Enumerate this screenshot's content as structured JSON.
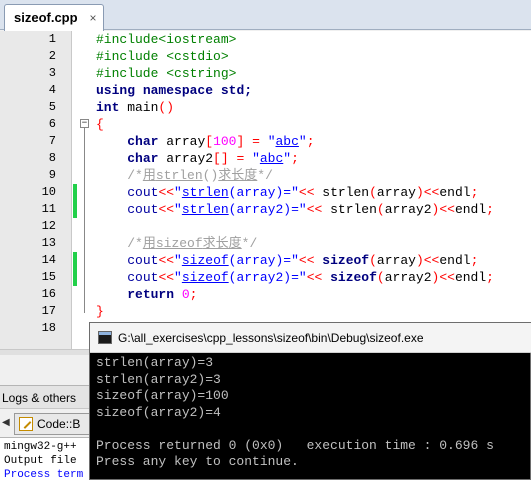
{
  "tab": {
    "filename": "sizeof.cpp",
    "close_glyph": "×"
  },
  "editor": {
    "line_numbers": [
      "1",
      "2",
      "3",
      "4",
      "5",
      "6",
      "7",
      "8",
      "9",
      "10",
      "11",
      "12",
      "13",
      "14",
      "15",
      "16",
      "17",
      "18"
    ],
    "code": {
      "l1": "#include<iostream>",
      "l2": "#include <cstdio>",
      "l3": "#include <cstring>",
      "l4_kw1": "using",
      "l4_kw2": "namespace",
      "l4_rest": " std;",
      "l5_type": "int",
      "l5_name": " main",
      "l5_parens": "()",
      "l6": "{",
      "l7_type": "char",
      "l7_var": " array",
      "l7_ob": "[",
      "l7_num": "100",
      "l7_cb": "]",
      "l7_eq": " = ",
      "l7_q1": "\"",
      "l7_str": "abc",
      "l7_q2": "\"",
      "l7_semi": ";",
      "l8_type": "char",
      "l8_var": " array2",
      "l8_brk": "[]",
      "l8_eq": " = ",
      "l8_q1": "\"",
      "l8_str": "abc",
      "l8_q2": "\"",
      "l8_semi": ";",
      "l9_open": "/*",
      "l9_han1": "用",
      "l9_fn": "strlen",
      "l9_paren": "()",
      "l9_han2": "求长度",
      "l9_close": "*/",
      "l10_cout": "cout",
      "l10_op": "<<",
      "l10_q1": "\"",
      "l10_fn": "strlen",
      "l10_strrest": "(array)=\"",
      "l10_op2": "<<",
      "l10_call": " strlen",
      "l10_p1": "(",
      "l10_arg": "array",
      "l10_p2": ")",
      "l10_op3": "<<",
      "l10_endl": "endl",
      "l10_semi": ";",
      "l11_cout": "cout",
      "l11_op": "<<",
      "l11_q1": "\"",
      "l11_fn": "strlen",
      "l11_strrest": "(array2)=\"",
      "l11_op2": "<<",
      "l11_call": " strlen",
      "l11_p1": "(",
      "l11_arg": "array2",
      "l11_p2": ")",
      "l11_op3": "<<",
      "l11_endl": "endl",
      "l11_semi": ";",
      "l13_open": "/*",
      "l13_han1": "用",
      "l13_fn": "sizeof",
      "l13_han2": "求长度",
      "l13_close": "*/",
      "l14_cout": "cout",
      "l14_op": "<<",
      "l14_q1": "\"",
      "l14_fn": "sizeof",
      "l14_strrest": "(array)=\"",
      "l14_op2": "<< ",
      "l14_kw": "sizeof",
      "l14_p1": "(",
      "l14_arg": "array",
      "l14_p2": ")",
      "l14_op3": "<<",
      "l14_endl": "endl",
      "l14_semi": ";",
      "l15_cout": "cout",
      "l15_op": "<<",
      "l15_q1": "\"",
      "l15_fn": "sizeof",
      "l15_strrest": "(array2)=\"",
      "l15_op2": "<< ",
      "l15_kw": "sizeof",
      "l15_p1": "(",
      "l15_arg": "array2",
      "l15_p2": ")",
      "l15_op3": "<<",
      "l15_endl": "endl",
      "l15_semi": ";",
      "l16_kw": "return",
      "l16_num": " 0",
      "l16_semi": ";",
      "l17": "}"
    }
  },
  "logs": {
    "title": "Logs & others",
    "tab_label": "Code::B",
    "back_glyph": "◀",
    "lines": [
      "mingw32-g++",
      "Output file",
      "Process term"
    ]
  },
  "console": {
    "title": "G:\\all_exercises\\cpp_lessons\\sizeof\\bin\\Debug\\sizeof.exe",
    "lines": [
      "strlen(array)=3",
      "strlen(array2)=3",
      "sizeof(array)=100",
      "sizeof(array2)=4",
      "",
      "Process returned 0 (0x0)   execution time : 0.696 s",
      "Press any key to continue."
    ]
  },
  "colors": {
    "modified_marker": "#22d04a",
    "keyword": "#00007f",
    "string": "#0000ff",
    "preprocessor": "#008000",
    "operator": "#ff0000",
    "number": "#ff00ff",
    "comment": "#a0a0a0"
  }
}
